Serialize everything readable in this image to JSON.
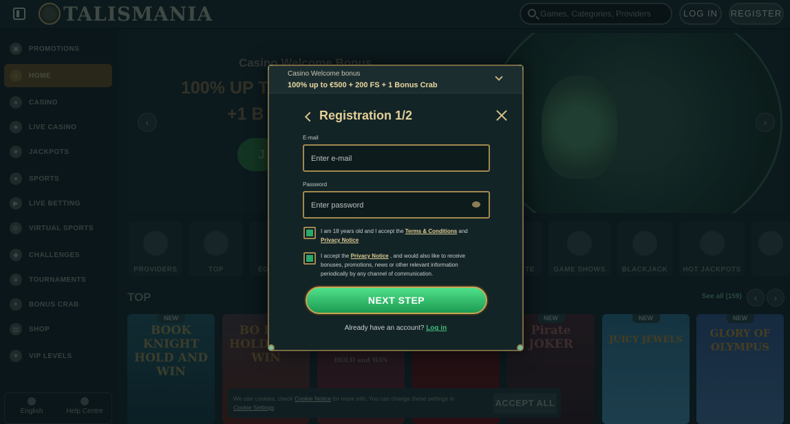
{
  "header": {
    "logo_text": "TALISMANIA",
    "search_placeholder": "Games, Categories, Providers",
    "login_label": "LOG IN",
    "register_label": "REGISTER"
  },
  "sidebar": {
    "items": [
      {
        "label": "PROMOTIONS",
        "icon": "gift-icon"
      },
      {
        "label": "HOME",
        "icon": "home-icon",
        "active": true
      },
      {
        "label": "CASINO",
        "icon": "casino-icon"
      },
      {
        "label": "LIVE CASINO",
        "icon": "live-casino-icon"
      },
      {
        "label": "JACKPOTS",
        "icon": "jackpots-icon"
      },
      {
        "label": "SPORTS",
        "icon": "sports-icon"
      },
      {
        "label": "LIVE BETTING",
        "icon": "live-betting-icon"
      },
      {
        "label": "VIRTUAL SPORTS",
        "icon": "virtual-sports-icon"
      },
      {
        "label": "CHALLENGES",
        "icon": "challenges-icon"
      },
      {
        "label": "TOURNAMENTS",
        "icon": "tournaments-icon"
      },
      {
        "label": "BONUS CRAB",
        "icon": "bonus-crab-icon"
      },
      {
        "label": "SHOP",
        "icon": "shop-icon"
      },
      {
        "label": "VIP LEVELS",
        "icon": "vip-icon"
      }
    ],
    "footer": {
      "language": "English",
      "help": "Help Centre"
    }
  },
  "banner": {
    "line1": "Casino Welcome Bonus",
    "line2": "100% UP T",
    "line3": "+1 B",
    "cta": "J"
  },
  "categories": [
    "PROVIDERS",
    "TOP",
    "EG",
    "TE",
    "GAME SHOWS",
    "BLACKJACK",
    "HOT JACKPOTS"
  ],
  "section": {
    "title": "TOP",
    "see_all": "See all (159)"
  },
  "games": [
    {
      "badge": "NEW",
      "title": "BOOK KNIGHT HOLD AND WIN"
    },
    {
      "badge": "",
      "title": "BO DRA HOLD AND WIN"
    },
    {
      "badge": "",
      "title": "HOLD and WIN"
    },
    {
      "badge": "",
      "title": ""
    },
    {
      "badge": "NEW",
      "title": "Pirate JOKER"
    },
    {
      "badge": "NEW",
      "title": "JUICY JEWELS"
    },
    {
      "badge": "NEW",
      "title": "GLORY OF OLYMPUS"
    }
  ],
  "cookie": {
    "text_before": "We use cookies, check ",
    "link1": "Cookie Notice",
    "text_mid": " for more info. You can change these settings in ",
    "link2": "Cookie Settings",
    "accept": "ACCEPT ALL"
  },
  "modal": {
    "bonus_small": "Casino Welcome bonus",
    "bonus_main": "100% up to €500 + 200 FS + 1 Bonus Crab",
    "title": "Registration 1/2",
    "email_label": "E-mail",
    "email_placeholder": "Enter e-mail",
    "password_label": "Password",
    "password_placeholder": "Enter password",
    "check1": {
      "pre": "I am 18 years old and I accept the ",
      "link1": "Terms & Conditions",
      "mid": " and ",
      "link2": "Privacy Notice"
    },
    "check2": {
      "pre": "I accept the ",
      "link": "Privacy Notice",
      "post": " , and would also like to receive bonuses, promotions, news or other relevant information periodically by any channel of communication."
    },
    "next_label": "NEXT STEP",
    "account_prompt": "Already have an account? ",
    "login_link": "Log in"
  }
}
